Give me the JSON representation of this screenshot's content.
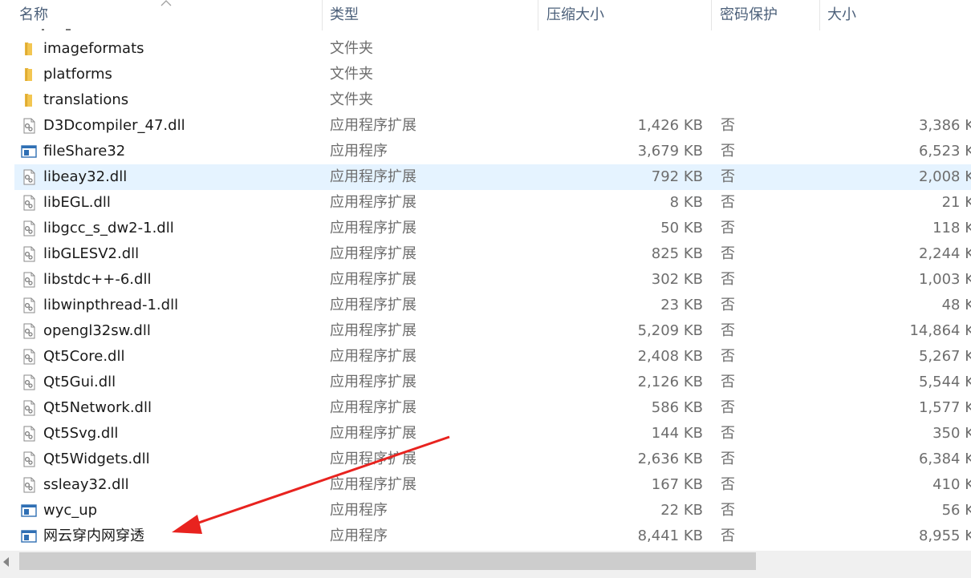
{
  "header": {
    "col_name": "名称",
    "col_type": "类型",
    "col_compressed": "压缩大小",
    "col_password": "密码保护",
    "col_size": "大小"
  },
  "files": [
    {
      "name": "imageformats",
      "type": "文件夹",
      "csize": "",
      "prot": "",
      "size": "",
      "icon": "folder-icon"
    },
    {
      "name": "platforms",
      "type": "文件夹",
      "csize": "",
      "prot": "",
      "size": "",
      "icon": "folder-icon"
    },
    {
      "name": "translations",
      "type": "文件夹",
      "csize": "",
      "prot": "",
      "size": "",
      "icon": "folder-icon"
    },
    {
      "name": "D3Dcompiler_47.dll",
      "type": "应用程序扩展",
      "csize": "1,426 KB",
      "prot": "否",
      "size": "3,386 K",
      "icon": "dll-icon"
    },
    {
      "name": "fileShare32",
      "type": "应用程序",
      "csize": "3,679 KB",
      "prot": "否",
      "size": "6,523 K",
      "icon": "exe-icon"
    },
    {
      "name": "libeay32.dll",
      "type": "应用程序扩展",
      "csize": "792 KB",
      "prot": "否",
      "size": "2,008 K",
      "icon": "dll-icon",
      "selected": true
    },
    {
      "name": "libEGL.dll",
      "type": "应用程序扩展",
      "csize": "8 KB",
      "prot": "否",
      "size": "21 K",
      "icon": "dll-icon"
    },
    {
      "name": "libgcc_s_dw2-1.dll",
      "type": "应用程序扩展",
      "csize": "50 KB",
      "prot": "否",
      "size": "118 K",
      "icon": "dll-icon"
    },
    {
      "name": "libGLESV2.dll",
      "type": "应用程序扩展",
      "csize": "825 KB",
      "prot": "否",
      "size": "2,244 K",
      "icon": "dll-icon"
    },
    {
      "name": "libstdc++-6.dll",
      "type": "应用程序扩展",
      "csize": "302 KB",
      "prot": "否",
      "size": "1,003 K",
      "icon": "dll-icon"
    },
    {
      "name": "libwinpthread-1.dll",
      "type": "应用程序扩展",
      "csize": "23 KB",
      "prot": "否",
      "size": "48 K",
      "icon": "dll-icon"
    },
    {
      "name": "opengl32sw.dll",
      "type": "应用程序扩展",
      "csize": "5,209 KB",
      "prot": "否",
      "size": "14,864 K",
      "icon": "dll-icon"
    },
    {
      "name": "Qt5Core.dll",
      "type": "应用程序扩展",
      "csize": "2,408 KB",
      "prot": "否",
      "size": "5,267 K",
      "icon": "dll-icon"
    },
    {
      "name": "Qt5Gui.dll",
      "type": "应用程序扩展",
      "csize": "2,126 KB",
      "prot": "否",
      "size": "5,544 K",
      "icon": "dll-icon"
    },
    {
      "name": "Qt5Network.dll",
      "type": "应用程序扩展",
      "csize": "586 KB",
      "prot": "否",
      "size": "1,577 K",
      "icon": "dll-icon"
    },
    {
      "name": "Qt5Svg.dll",
      "type": "应用程序扩展",
      "csize": "144 KB",
      "prot": "否",
      "size": "350 K",
      "icon": "dll-icon"
    },
    {
      "name": "Qt5Widgets.dll",
      "type": "应用程序扩展",
      "csize": "2,636 KB",
      "prot": "否",
      "size": "6,384 K",
      "icon": "dll-icon"
    },
    {
      "name": "ssleay32.dll",
      "type": "应用程序扩展",
      "csize": "167 KB",
      "prot": "否",
      "size": "410 K",
      "icon": "dll-icon"
    },
    {
      "name": "wyc_up",
      "type": "应用程序",
      "csize": "22 KB",
      "prot": "否",
      "size": "56 K",
      "icon": "exe-icon"
    },
    {
      "name": "网云穿内网穿透",
      "type": "应用程序",
      "csize": "8,441 KB",
      "prot": "否",
      "size": "8,955 K",
      "icon": "exe-icon"
    }
  ],
  "colors": {
    "header_text": "#4c607a",
    "selected_row": "#e5f3ff",
    "annotation_arrow": "#e8231f",
    "folder": "#f3c651"
  }
}
